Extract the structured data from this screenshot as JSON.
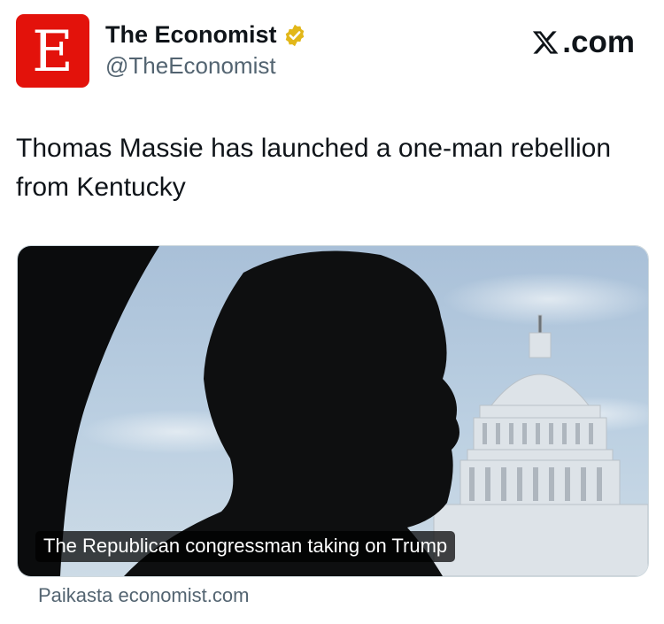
{
  "account": {
    "logo_letter": "E",
    "display_name": "The Economist",
    "handle": "@TheEconomist",
    "verified": true
  },
  "platform": {
    "brand": ".com"
  },
  "tweet": {
    "text": "Thomas Massie has launched a one-man rebellion from Kentucky"
  },
  "card": {
    "caption": "The Republican congressman taking on Trump",
    "source_label": "Paikasta economist.com"
  },
  "colors": {
    "brand_red": "#e3120b",
    "verified_gold": "#e2b719",
    "muted_text": "#536471"
  },
  "icons": {
    "verified": "verified-badge-icon",
    "x_logo": "x-logo-icon"
  }
}
